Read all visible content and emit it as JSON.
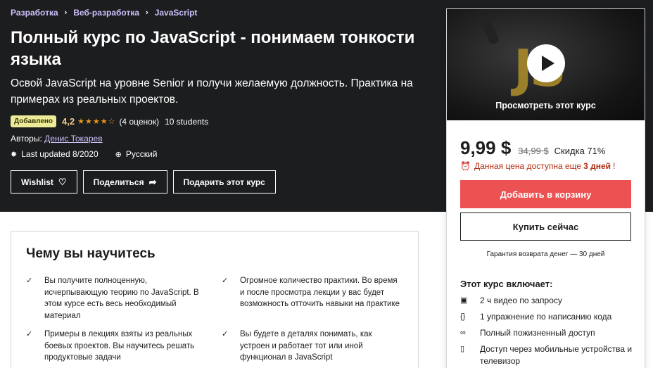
{
  "breadcrumb": [
    "Разработка",
    "Веб-разработка",
    "JavaScript"
  ],
  "course": {
    "title": "Полный курс по JavaScript - понимаем тонкости языка",
    "subtitle": "Освой JavaScript на уровне Senior и получи желаемую должность. Практика на примерах из реальных проектов.",
    "badge": "Добавлено",
    "rating": "4,2",
    "rating_stars": 4.2,
    "rating_count": "(4 оценок)",
    "students": "10 students",
    "authors_label": "Авторы:",
    "author": "Денис Токарев",
    "last_updated": "Last updated 8/2020",
    "language": "Русский"
  },
  "actions": {
    "wishlist": "Wishlist",
    "share": "Поделиться",
    "gift": "Подарить этот курс"
  },
  "sidebar": {
    "preview_label": "Просмотреть этот курс",
    "price_current": "9,99 $",
    "price_old": "34,99 $",
    "discount": "Скидка 71%",
    "timer_prefix": "Данная цена доступна еще",
    "timer_days": "3 дней",
    "timer_suffix": "!",
    "add_to_cart": "Добавить в корзину",
    "buy_now": "Купить сейчас",
    "guarantee": "Гарантия возврата денег — 30 дней",
    "includes_title": "Этот курс включает:",
    "includes": [
      {
        "icon": "video-icon",
        "text": "2 ч видео по запросу"
      },
      {
        "icon": "code-icon",
        "text": "1 упражнение по написанию кода"
      },
      {
        "icon": "infinity-icon",
        "text": "Полный пожизненный доступ"
      },
      {
        "icon": "mobile-icon",
        "text": "Доступ через мобильные устройства и телевизор"
      }
    ]
  },
  "learn": {
    "title": "Чему вы научитесь",
    "items": [
      "Вы получите полноценную, исчерпывающую теорию по JavaScript. В этом курсе есть весь необходимый материал",
      "Огромное количество практики. Во время и после просмотра лекции у вас будет возможность отточить навыки на практике",
      "Примеры в лекциях взяты из реальных боевых проектов. Вы научитесь решать продуктовые задачи",
      "Вы будете в деталях понимать, как устроен и работает тот или иной функционал в JavaScript"
    ]
  },
  "colors": {
    "header_bg": "#1c1d1f",
    "breadcrumb": "#cec0fc",
    "rating": "#f3ca8c",
    "stars": "#e59819",
    "badge_bg": "#eceb98",
    "cart_button": "#ec5252",
    "timer": "#b32d0f"
  }
}
